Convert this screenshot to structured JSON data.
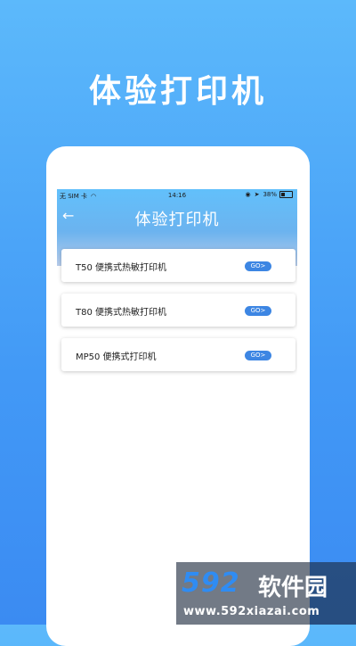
{
  "hero": {
    "title": "体验打印机"
  },
  "status_bar": {
    "carrier": "无 SIM 卡",
    "time": "14:16",
    "battery_percent": "38%",
    "battery_level": 0.38
  },
  "header": {
    "title": "体验打印机"
  },
  "printers": [
    {
      "label": "T50 便携式热敏打印机",
      "action": "GO>"
    },
    {
      "label": "T80 便携式热敏打印机",
      "action": "GO>"
    },
    {
      "label": "MP50 便携式打印机",
      "action": "GO>"
    }
  ],
  "watermark": {
    "logo": "592",
    "logo_cn": "软件园",
    "url": "www.592xiazai.com"
  },
  "colors": {
    "background": "#4299f6",
    "accent": "#3d86e3",
    "logo": "#2f8cf3"
  }
}
